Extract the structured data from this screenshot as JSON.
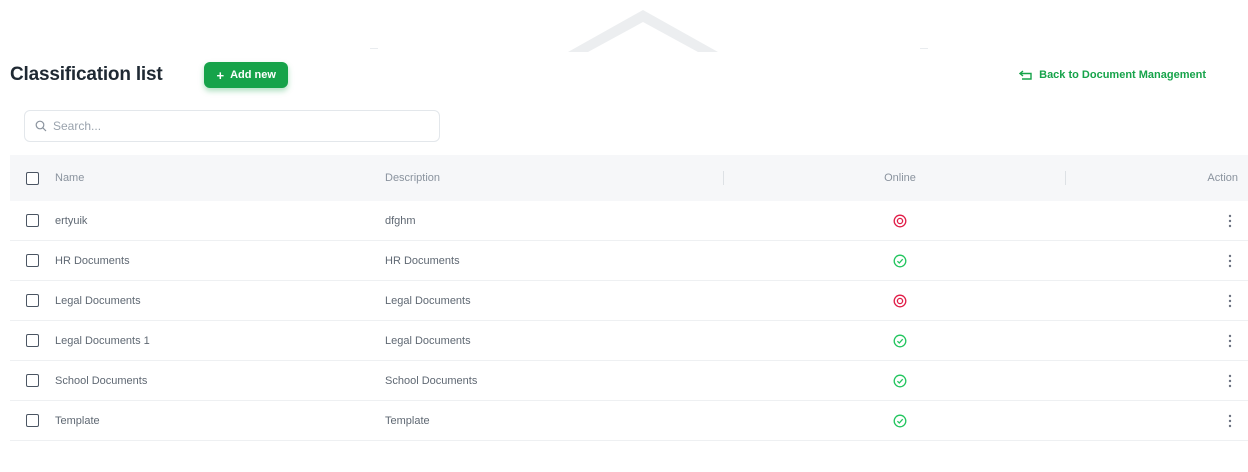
{
  "header": {
    "title": "Classification list",
    "add_button_label": "Add new",
    "back_link_label": "Back to Document Management"
  },
  "search": {
    "placeholder": "Search...",
    "value": ""
  },
  "table": {
    "columns": [
      "Name",
      "Description",
      "Online",
      "Action"
    ],
    "rows": [
      {
        "name": "ertyuik",
        "description": "dfghm",
        "online": false
      },
      {
        "name": "HR Documents",
        "description": "HR Documents",
        "online": true
      },
      {
        "name": "Legal Documents",
        "description": "Legal Documents",
        "online": false
      },
      {
        "name": "Legal Documents 1",
        "description": "Legal Documents",
        "online": true
      },
      {
        "name": "School Documents",
        "description": "School Documents",
        "online": true
      },
      {
        "name": "Template",
        "description": "Template",
        "online": true
      }
    ]
  },
  "icons": {
    "online_true": "check-circle-icon",
    "online_false": "x-circle-icon",
    "action": "kebab-menu-icon",
    "search": "search-icon",
    "back": "back-arrow-icon"
  },
  "colors": {
    "primary": "#16a34a",
    "offline": "#e11d48",
    "online": "#22c55e"
  }
}
